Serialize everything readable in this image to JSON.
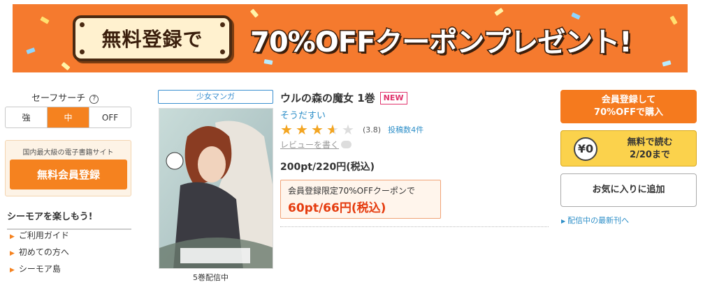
{
  "banner": {
    "plate_text": "無料登録で",
    "headline": "70%OFFクーポンプレゼント!"
  },
  "sidebar": {
    "safe_search_label": "セーフサーチ",
    "help_symbol": "?",
    "safe_options": [
      "強",
      "中",
      "OFF"
    ],
    "safe_selected": "中",
    "register_caption": "国内最大級の電子書籍サイト",
    "register_button": "無料会員登録",
    "enjoy_heading": "シーモアを楽しもう!",
    "links": [
      "ご利用ガイド",
      "初めての方へ",
      "シーモア島"
    ]
  },
  "product": {
    "genre": "少女マンガ",
    "cover_status": "5巻配信中",
    "title": "ウルの森の魔女 1巻",
    "badge": "NEW",
    "author": "そうだすい",
    "rating_value": 3.5,
    "rating_text": "(3.8)",
    "review_count": "投稿数4件",
    "write_review": "レビューを書く",
    "price": "200pt/220円(税込)",
    "coupon_label": "会員登録限定70%OFFクーポンで",
    "coupon_price": "60pt/66円(税込)"
  },
  "actions": {
    "buy_line1": "会員登録して",
    "buy_line2": "70%OFFで購入",
    "free_badge": "¥0",
    "free_line1": "無料で読む",
    "free_line2": "2/20まで",
    "favorite": "お気に入りに追加",
    "latest": "配信中の最新刊へ"
  },
  "colors": {
    "accent": "#f5821f",
    "link": "#2e8fc8",
    "coupon_red": "#e53c0f",
    "free_yellow": "#fbd24c",
    "star": "#f3a522"
  }
}
